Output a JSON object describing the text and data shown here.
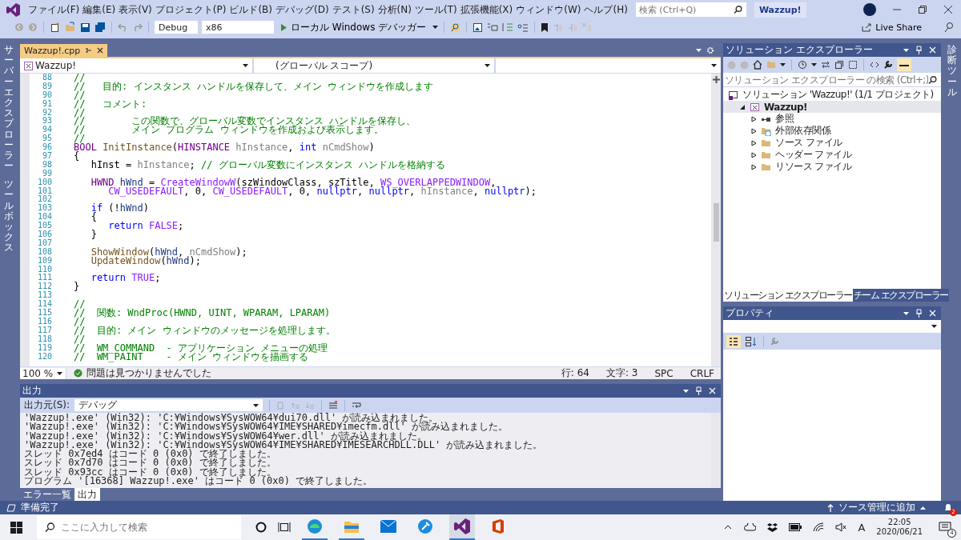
{
  "menu": [
    "ファイル(F)",
    "編集(E)",
    "表示(V)",
    "プロジェクト(P)",
    "ビルド(B)",
    "デバッグ(D)",
    "テスト(S)",
    "分析(N)",
    "ツール(T)",
    "拡張機能(X)",
    "ウィンドウ(W)",
    "ヘルプ(H)"
  ],
  "search": {
    "placeholder": "検索 (Ctrl+Q)"
  },
  "solution_badge": "Wazzup!",
  "toolbar": {
    "configuration": "Debug",
    "platform": "x86",
    "run_label": "ローカル Windows デバッガー",
    "live_share": "Live Share"
  },
  "side_tabs_left": [
    "サーバーエクスプローラー",
    "ツールボックス"
  ],
  "side_tabs_right": [
    "診断ツール"
  ],
  "editor": {
    "tabs": [
      {
        "label": "Wazzup!.cpp",
        "selected": true
      }
    ],
    "nav": {
      "project": "Wazzup!",
      "scope": "(グローバル スコープ)"
    },
    "lines": [
      {
        "number": "88",
        "tokens": [
          {
            "kind": "comment",
            "text": "//"
          }
        ]
      },
      {
        "number": "89",
        "tokens": [
          {
            "kind": "comment",
            "text": "//   目的: インスタンス ハンドルを保存して、メイン ウィンドウを作成します"
          }
        ]
      },
      {
        "number": "90",
        "tokens": [
          {
            "kind": "comment",
            "text": "//"
          }
        ]
      },
      {
        "number": "91",
        "tokens": [
          {
            "kind": "comment",
            "text": "//   コメント:"
          }
        ]
      },
      {
        "number": "92",
        "tokens": [
          {
            "kind": "comment",
            "text": "//"
          }
        ]
      },
      {
        "number": "93",
        "tokens": [
          {
            "kind": "comment",
            "text": "//        この関数で、グローバル変数でインスタンス ハンドルを保存し、"
          }
        ]
      },
      {
        "number": "94",
        "tokens": [
          {
            "kind": "comment",
            "text": "//        メイン プログラム ウィンドウを作成および表示します。"
          }
        ]
      },
      {
        "number": "95",
        "tokens": [
          {
            "kind": "comment",
            "text": "//"
          }
        ]
      },
      {
        "number": "96",
        "tokens": [
          {
            "kind": "type",
            "text": "BOOL"
          },
          {
            "kind": "function",
            "text": " InitInstance"
          },
          {
            "kind": "plain",
            "text": "("
          },
          {
            "kind": "type",
            "text": "HINSTANCE"
          },
          {
            "kind": "param",
            "text": " hInstance"
          },
          {
            "kind": "plain",
            "text": ", "
          },
          {
            "kind": "keyword",
            "text": "int"
          },
          {
            "kind": "param",
            "text": " nCmdShow"
          },
          {
            "kind": "plain",
            "text": ")"
          }
        ]
      },
      {
        "number": "97",
        "tokens": [
          {
            "kind": "plain",
            "text": "{"
          }
        ]
      },
      {
        "number": "98",
        "tokens": [
          {
            "kind": "plain",
            "text": "   hInst = "
          },
          {
            "kind": "param",
            "text": "hInstance"
          },
          {
            "kind": "plain",
            "text": "; "
          },
          {
            "kind": "comment",
            "text": "// グローバル変数にインスタンス ハンドルを格納する"
          }
        ]
      },
      {
        "number": "99"
      },
      {
        "number": "100",
        "tokens": [
          {
            "kind": "type",
            "text": "   HWND"
          },
          {
            "kind": "local",
            "text": " hWnd"
          },
          {
            "kind": "plain",
            "text": " = "
          },
          {
            "kind": "macro",
            "text": "CreateWindowW"
          },
          {
            "kind": "plain",
            "text": "(szWindowClass, szTitle, "
          },
          {
            "kind": "macro",
            "text": "WS_OVERLAPPEDWINDOW"
          },
          {
            "kind": "plain",
            "text": ","
          }
        ]
      },
      {
        "number": "101",
        "tokens": [
          {
            "kind": "macro",
            "text": "      CW_USEDEFAULT"
          },
          {
            "kind": "plain",
            "text": ", 0, "
          },
          {
            "kind": "macro",
            "text": "CW_USEDEFAULT"
          },
          {
            "kind": "plain",
            "text": ", 0, "
          },
          {
            "kind": "keyword",
            "text": "nullptr"
          },
          {
            "kind": "plain",
            "text": ", "
          },
          {
            "kind": "keyword",
            "text": "nullptr"
          },
          {
            "kind": "plain",
            "text": ", "
          },
          {
            "kind": "param",
            "text": "hInstance"
          },
          {
            "kind": "plain",
            "text": ", "
          },
          {
            "kind": "keyword",
            "text": "nullptr"
          },
          {
            "kind": "plain",
            "text": ");"
          }
        ]
      },
      {
        "number": "102"
      },
      {
        "number": "103",
        "tokens": [
          {
            "kind": "keyword",
            "text": "   if"
          },
          {
            "kind": "plain",
            "text": " (!"
          },
          {
            "kind": "local",
            "text": "hWnd"
          },
          {
            "kind": "plain",
            "text": ")"
          }
        ]
      },
      {
        "number": "104",
        "tokens": [
          {
            "kind": "plain",
            "text": "   {"
          }
        ]
      },
      {
        "number": "105",
        "tokens": [
          {
            "kind": "keyword",
            "text": "      return"
          },
          {
            "kind": "macro",
            "text": " FALSE"
          },
          {
            "kind": "plain",
            "text": ";"
          }
        ]
      },
      {
        "number": "106",
        "tokens": [
          {
            "kind": "plain",
            "text": "   }"
          }
        ]
      },
      {
        "number": "107"
      },
      {
        "number": "108",
        "tokens": [
          {
            "kind": "function",
            "text": "   ShowWindow"
          },
          {
            "kind": "plain",
            "text": "("
          },
          {
            "kind": "local",
            "text": "hWnd"
          },
          {
            "kind": "plain",
            "text": ", "
          },
          {
            "kind": "param",
            "text": "nCmdShow"
          },
          {
            "kind": "plain",
            "text": ");"
          }
        ]
      },
      {
        "number": "109",
        "tokens": [
          {
            "kind": "function",
            "text": "   UpdateWindow"
          },
          {
            "kind": "plain",
            "text": "("
          },
          {
            "kind": "local",
            "text": "hWnd"
          },
          {
            "kind": "plain",
            "text": ");"
          }
        ]
      },
      {
        "number": "110"
      },
      {
        "number": "111",
        "tokens": [
          {
            "kind": "keyword",
            "text": "   return"
          },
          {
            "kind": "macro",
            "text": " TRUE"
          },
          {
            "kind": "plain",
            "text": ";"
          }
        ]
      },
      {
        "number": "112",
        "tokens": [
          {
            "kind": "plain",
            "text": "}"
          }
        ]
      },
      {
        "number": "113"
      },
      {
        "number": "114",
        "tokens": [
          {
            "kind": "comment",
            "text": "//"
          }
        ]
      },
      {
        "number": "115",
        "tokens": [
          {
            "kind": "comment",
            "text": "//  関数: WndProc(HWND, UINT, WPARAM, LPARAM)"
          }
        ]
      },
      {
        "number": "116",
        "tokens": [
          {
            "kind": "comment",
            "text": "//"
          }
        ]
      },
      {
        "number": "117",
        "tokens": [
          {
            "kind": "comment",
            "text": "//  目的: メイン ウィンドウのメッセージを処理します。"
          }
        ]
      },
      {
        "number": "118",
        "tokens": [
          {
            "kind": "comment",
            "text": "//"
          }
        ]
      },
      {
        "number": "119",
        "tokens": [
          {
            "kind": "comment",
            "text": "//  WM_COMMAND  - アプリケーション メニューの処理"
          }
        ]
      },
      {
        "number": "120",
        "tokens": [
          {
            "kind": "comment",
            "text": "//  WM_PAINT    - メイン ウィンドウを描画する"
          }
        ]
      }
    ],
    "status": {
      "zoom": "100 %",
      "issues": "問題は見つかりませんでした",
      "line": "行: 64",
      "char": "文字: 3",
      "whitespace": "SPC",
      "line_ending": "CRLF"
    }
  },
  "output": {
    "title": "出力",
    "source_label": "出力元(S):",
    "source": "デバッグ",
    "lines": [
      "'Wazzup!.exe' (Win32): 'C:¥Windows¥SysWOW64¥dui70.dll' が読み込まれました。",
      "'Wazzup!.exe' (Win32): 'C:¥Windows¥SysWOW64¥IME¥SHARED¥imecfm.dll' が読み込まれました。",
      "'Wazzup!.exe' (Win32): 'C:¥Windows¥SysWOW64¥wer.dll' が読み込まれました。",
      "'Wazzup!.exe' (Win32): 'C:¥Windows¥SysWOW64¥IME¥SHARED¥IMESEARCHDLL.DLL' が読み込まれました。",
      "スレッド 0x7ed4 はコード 0 (0x0) で終了しました。",
      "スレッド 0x7d70 はコード 0 (0x0) で終了しました。",
      "スレッド 0x93cc はコード 0 (0x0) で終了しました。",
      "プログラム '[16368] Wazzup!.exe' はコード 0 (0x0) で終了しました。"
    ],
    "tabs": [
      {
        "label": "エラー一覧",
        "selected": false
      },
      {
        "label": "出力",
        "selected": true
      }
    ]
  },
  "solution_explorer": {
    "title": "ソリューション エクスプローラー",
    "search_placeholder": "ソリューション エクスプローラー の検索 (Ctrl+;)",
    "tree": [
      {
        "kind": "solution",
        "label": "ソリューション 'Wazzup!' (1/1 プロジェクト)",
        "selected": false,
        "children": [
          {
            "kind": "project",
            "label": "Wazzup!",
            "selected": true,
            "expanded": true,
            "children": [
              {
                "kind": "references",
                "label": "参照",
                "selected": false,
                "expanded": false
              },
              {
                "kind": "dependencies",
                "label": "外部依存関係",
                "selected": false,
                "expanded": false
              },
              {
                "kind": "folder",
                "label": "ソース ファイル",
                "selected": false,
                "expanded": false
              },
              {
                "kind": "folder",
                "label": "ヘッダー ファイル",
                "selected": false,
                "expanded": false
              },
              {
                "kind": "folder",
                "label": "リソース ファイル",
                "selected": false,
                "expanded": false
              }
            ]
          }
        ]
      }
    ],
    "tabs": [
      {
        "label": "ソリューション エクスプローラー",
        "selected": true
      },
      {
        "label": "チーム エクスプローラー",
        "selected": false
      }
    ]
  },
  "properties": {
    "title": "プロパティ"
  },
  "status_bar": {
    "message": "準備完了",
    "source_control": "ソース管理に追加",
    "notifications": "2"
  },
  "taskbar": {
    "search_placeholder": "ここに入力して検索",
    "ime": "A",
    "time": "22:05",
    "date": "2020/06/21",
    "notifications": "4"
  }
}
